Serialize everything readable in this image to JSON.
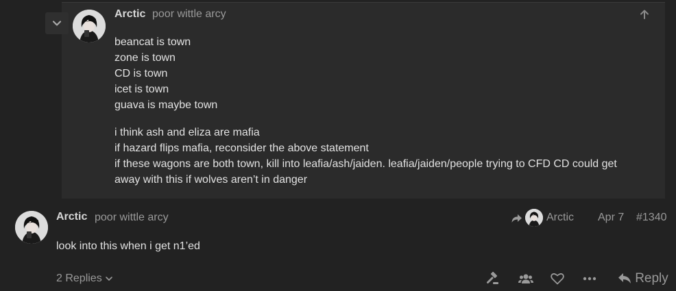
{
  "quote": {
    "username": "Arctic",
    "user_title": "poor wittle arcy",
    "paragraph1": [
      "beancat is town",
      "zone is town",
      "CD is town",
      "icet is town",
      "guava is maybe town"
    ],
    "paragraph2": [
      "i think ash and eliza are mafia",
      "if hazard flips mafia, reconsider the above statement",
      "if these wagons are both town, kill into leafia/ash/jaiden. leafia/jaiden/people trying to CFD CD could get",
      "away with this if wolves aren’t in danger"
    ]
  },
  "post": {
    "username": "Arctic",
    "user_title": "poor wittle arcy",
    "reply_to_name": "Arctic",
    "date": "Apr 7",
    "post_number": "#1340",
    "body": "look into this when i get n1’ed",
    "replies_label": "2 Replies",
    "reply_button": "Reply"
  },
  "icons": [
    "chevron-down",
    "arrow-up",
    "share-arrow",
    "gavel",
    "users",
    "heart",
    "ellipsis",
    "reply-arrow"
  ],
  "colors": {
    "background": "#222222",
    "quote_background": "#2b2b2b",
    "muted_text": "#9a9a9a",
    "text": "#e2e2e2"
  }
}
